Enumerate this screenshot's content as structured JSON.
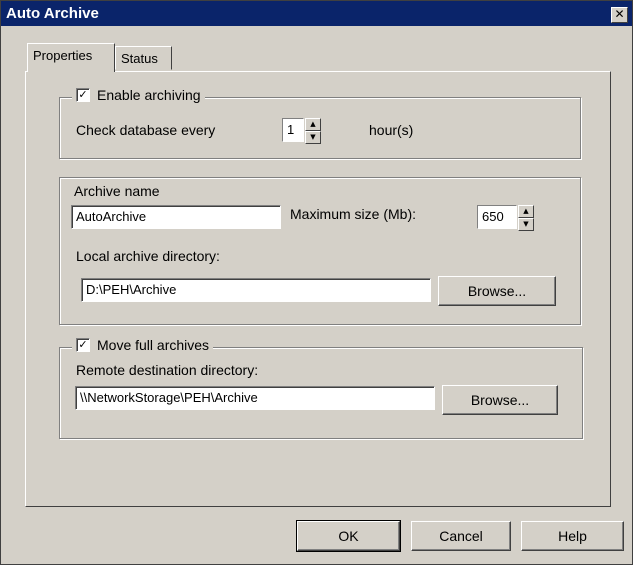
{
  "window": {
    "title": "Auto Archive",
    "close_glyph": "✕"
  },
  "tabs": [
    {
      "label": "Properties",
      "active": true
    },
    {
      "label": "Status",
      "active": false
    }
  ],
  "archiving_group": {
    "enable_label": "Enable archiving",
    "enable_checked": true,
    "check_label": "Check database every",
    "check_value": "1",
    "unit_label": "hour(s)"
  },
  "archive_group": {
    "name_label": "Archive name",
    "name_value": "AutoArchive",
    "max_size_label": "Maximum size (Mb):",
    "max_size_value": "650",
    "local_dir_label": "Local archive directory:",
    "local_dir_value": "D:\\PEH\\Archive",
    "browse_label": "Browse..."
  },
  "move_group": {
    "move_label": "Move full archives",
    "move_checked": true,
    "remote_dir_label": "Remote destination directory:",
    "remote_dir_value": "\\\\NetworkStorage\\PEH\\Archive",
    "browse_label": "Browse..."
  },
  "footer": {
    "ok_label": "OK",
    "cancel_label": "Cancel",
    "help_label": "Help"
  },
  "icons": {
    "check": "✓",
    "spin_up": "▲",
    "spin_down": "▼"
  }
}
